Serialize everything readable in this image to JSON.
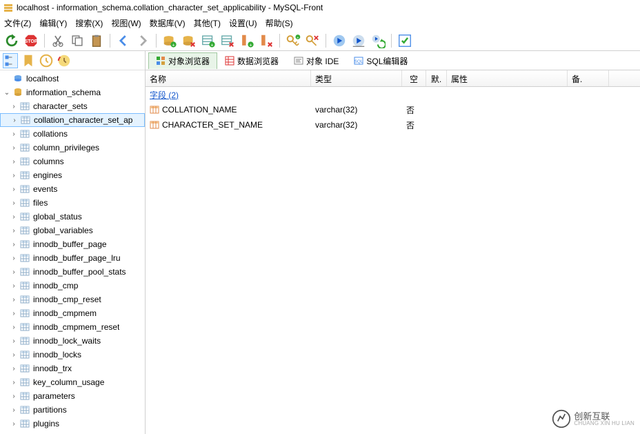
{
  "window": {
    "title": "localhost - information_schema.collation_character_set_applicability - MySQL-Front"
  },
  "menu": {
    "file": "文件(Z)",
    "edit": "编辑(Y)",
    "search": "搜索(X)",
    "view": "视图(W)",
    "database": "数据库(V)",
    "misc": "其他(T)",
    "settings": "设置(U)",
    "help": "帮助(S)"
  },
  "toolbar": {
    "refresh": "refresh",
    "stop": "stop",
    "cut": "cut",
    "copy": "copy",
    "paste": "paste",
    "back": "back",
    "forward": "forward",
    "db_add": "db_add",
    "db_del": "db_del",
    "tbl_add": "tbl_add",
    "tbl_del": "tbl_del",
    "col_add": "col_add",
    "col_del": "col_del",
    "pk": "pk",
    "undo": "undo",
    "redo": "redo",
    "run": "run",
    "plan": "plan",
    "apply": "apply"
  },
  "left_toolbar": {
    "a": "tree-view",
    "b": "bookmark",
    "c": "history",
    "d": "schedule"
  },
  "tree": {
    "root": "localhost",
    "db": "information_schema",
    "tables": [
      "character_sets",
      "collation_character_set_ap",
      "collations",
      "column_privileges",
      "columns",
      "engines",
      "events",
      "files",
      "global_status",
      "global_variables",
      "innodb_buffer_page",
      "innodb_buffer_page_lru",
      "innodb_buffer_pool_stats",
      "innodb_cmp",
      "innodb_cmp_reset",
      "innodb_cmpmem",
      "innodb_cmpmem_reset",
      "innodb_lock_waits",
      "innodb_locks",
      "innodb_trx",
      "key_column_usage",
      "parameters",
      "partitions",
      "plugins"
    ],
    "selected_index": 1
  },
  "tabs": {
    "object_browser": "对象浏览器",
    "data_browser": "数据浏览器",
    "object_ide": "对象 IDE",
    "sql_editor": "SQL编辑器",
    "active": 0
  },
  "grid": {
    "headers": {
      "name": "名称",
      "type": "类型",
      "null": "空",
      "default": "默.",
      "attr": "属性",
      "remark": "备."
    },
    "section": "字段 (2)",
    "rows": [
      {
        "name": "COLLATION_NAME",
        "type": "varchar(32)",
        "null": "否",
        "default": "",
        "attr": "",
        "remark": ""
      },
      {
        "name": "CHARACTER_SET_NAME",
        "type": "varchar(32)",
        "null": "否",
        "default": "",
        "attr": "",
        "remark": ""
      }
    ]
  },
  "watermark": {
    "cn": "创新互联",
    "en": "CHUANG XIN HU LIAN"
  }
}
